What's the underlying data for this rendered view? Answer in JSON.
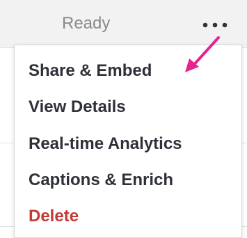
{
  "header": {
    "status": "Ready",
    "more_icon": "more-horizontal-icon"
  },
  "menu": {
    "items": [
      {
        "label": "Share & Embed",
        "danger": false
      },
      {
        "label": "View Details",
        "danger": false
      },
      {
        "label": "Real-time Analytics",
        "danger": false
      },
      {
        "label": "Captions & Enrich",
        "danger": false
      },
      {
        "label": "Delete",
        "danger": true
      }
    ]
  },
  "annotation": {
    "icon": "arrow-icon",
    "color": "#e4258d"
  },
  "colors": {
    "menu_text": "#2e3138",
    "danger_text": "#c23b35",
    "status_text": "#8a8a8a"
  }
}
